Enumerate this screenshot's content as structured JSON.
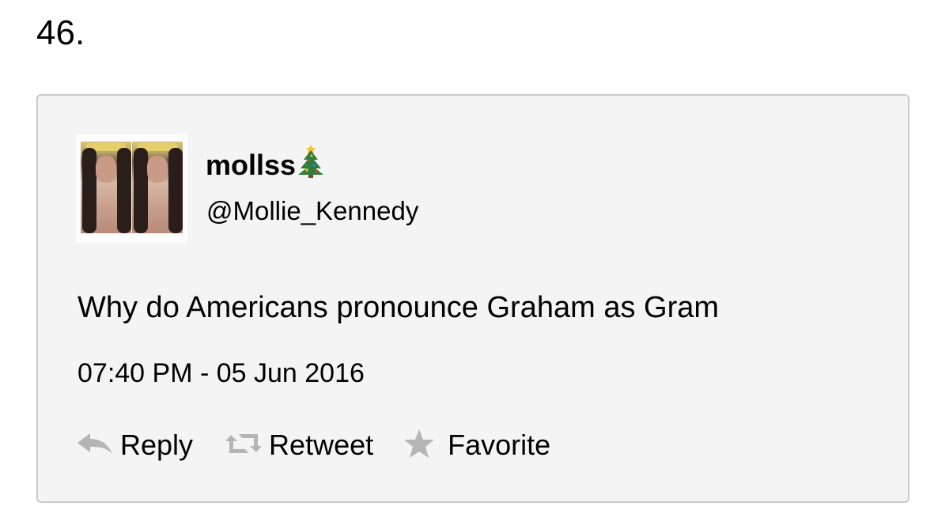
{
  "item_number": "46.",
  "tweet": {
    "display_name": "mollss",
    "name_emoji": "christmas-tree-icon",
    "handle": "@Mollie_Kennedy",
    "text": "Why do Americans pronounce Graham as Gram",
    "timestamp": "07:40 PM - 05 Jun 2016",
    "actions": {
      "reply": "Reply",
      "retweet": "Retweet",
      "favorite": "Favorite"
    }
  },
  "colors": {
    "card_background": "#f4f4f4",
    "card_border": "#c9c9c9",
    "icon_gray": "#b5b5b5"
  }
}
